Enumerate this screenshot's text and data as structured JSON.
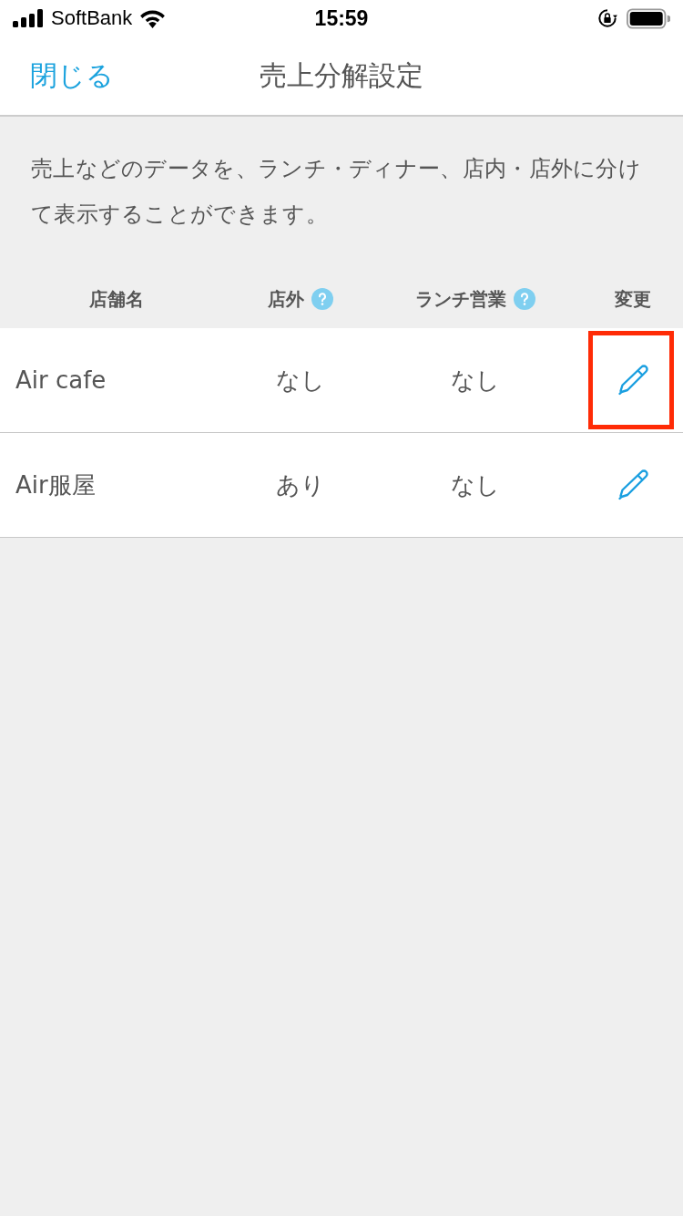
{
  "status_bar": {
    "carrier": "SoftBank",
    "time": "15:59"
  },
  "nav": {
    "close": "閉じる",
    "title": "売上分解設定"
  },
  "description": "売上などのデータを、ランチ・ディナー、店内・店外に分けて表示することができます。",
  "table": {
    "columns": [
      {
        "label": "店舗名",
        "help": false
      },
      {
        "label": "店外",
        "help": true
      },
      {
        "label": "ランチ営業",
        "help": true
      },
      {
        "label": "変更",
        "help": false
      }
    ],
    "rows": [
      {
        "cells": [
          "Air cafe",
          "なし",
          "なし"
        ],
        "highlighted": true
      },
      {
        "cells": [
          "Air服屋",
          "あり",
          "なし"
        ],
        "highlighted": false
      }
    ]
  }
}
